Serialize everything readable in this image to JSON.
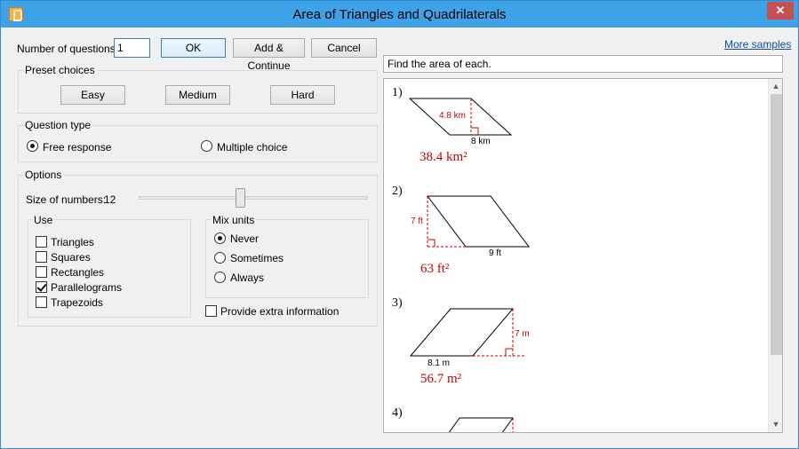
{
  "window": {
    "title": "Area of Triangles and Quadrilaterals",
    "close": "✕"
  },
  "top": {
    "num_questions_label": "Number of questions:",
    "num_questions_value": "1",
    "ok": "OK",
    "add_continue": "Add & Continue",
    "cancel": "Cancel"
  },
  "preset": {
    "title": "Preset choices",
    "easy": "Easy",
    "medium": "Medium",
    "hard": "Hard"
  },
  "question_type": {
    "title": "Question type",
    "options": [
      "Free response",
      "Multiple choice"
    ],
    "selected": "Free response"
  },
  "options": {
    "title": "Options",
    "size_label": "Size of numbers:",
    "size_value": "12",
    "use_title": "Use",
    "use_items": [
      {
        "label": "Triangles",
        "checked": false
      },
      {
        "label": "Squares",
        "checked": false
      },
      {
        "label": "Rectangles",
        "checked": false
      },
      {
        "label": "Parallelograms",
        "checked": true
      },
      {
        "label": "Trapezoids",
        "checked": false
      }
    ],
    "mix_title": "Mix units",
    "mix_items": [
      "Never",
      "Sometimes",
      "Always"
    ],
    "mix_selected": "Never",
    "extra_info": "Provide extra information",
    "extra_checked": false
  },
  "right": {
    "more_samples": "More samples",
    "instructions": "Find the area of each."
  },
  "problems": [
    {
      "num": "1)",
      "height": "4.8 km",
      "base": "8 km",
      "answer": "38.4 km²"
    },
    {
      "num": "2)",
      "height": "7 ft",
      "base": "9 ft",
      "answer": "63 ft²"
    },
    {
      "num": "3)",
      "height": "7 m",
      "base": "8.1 m",
      "answer": "56.7 m²"
    },
    {
      "num": "4)"
    }
  ],
  "colors": {
    "title_bar": "#3fa2e6",
    "answer": "#cc0000",
    "link": "#0b4fa8"
  }
}
